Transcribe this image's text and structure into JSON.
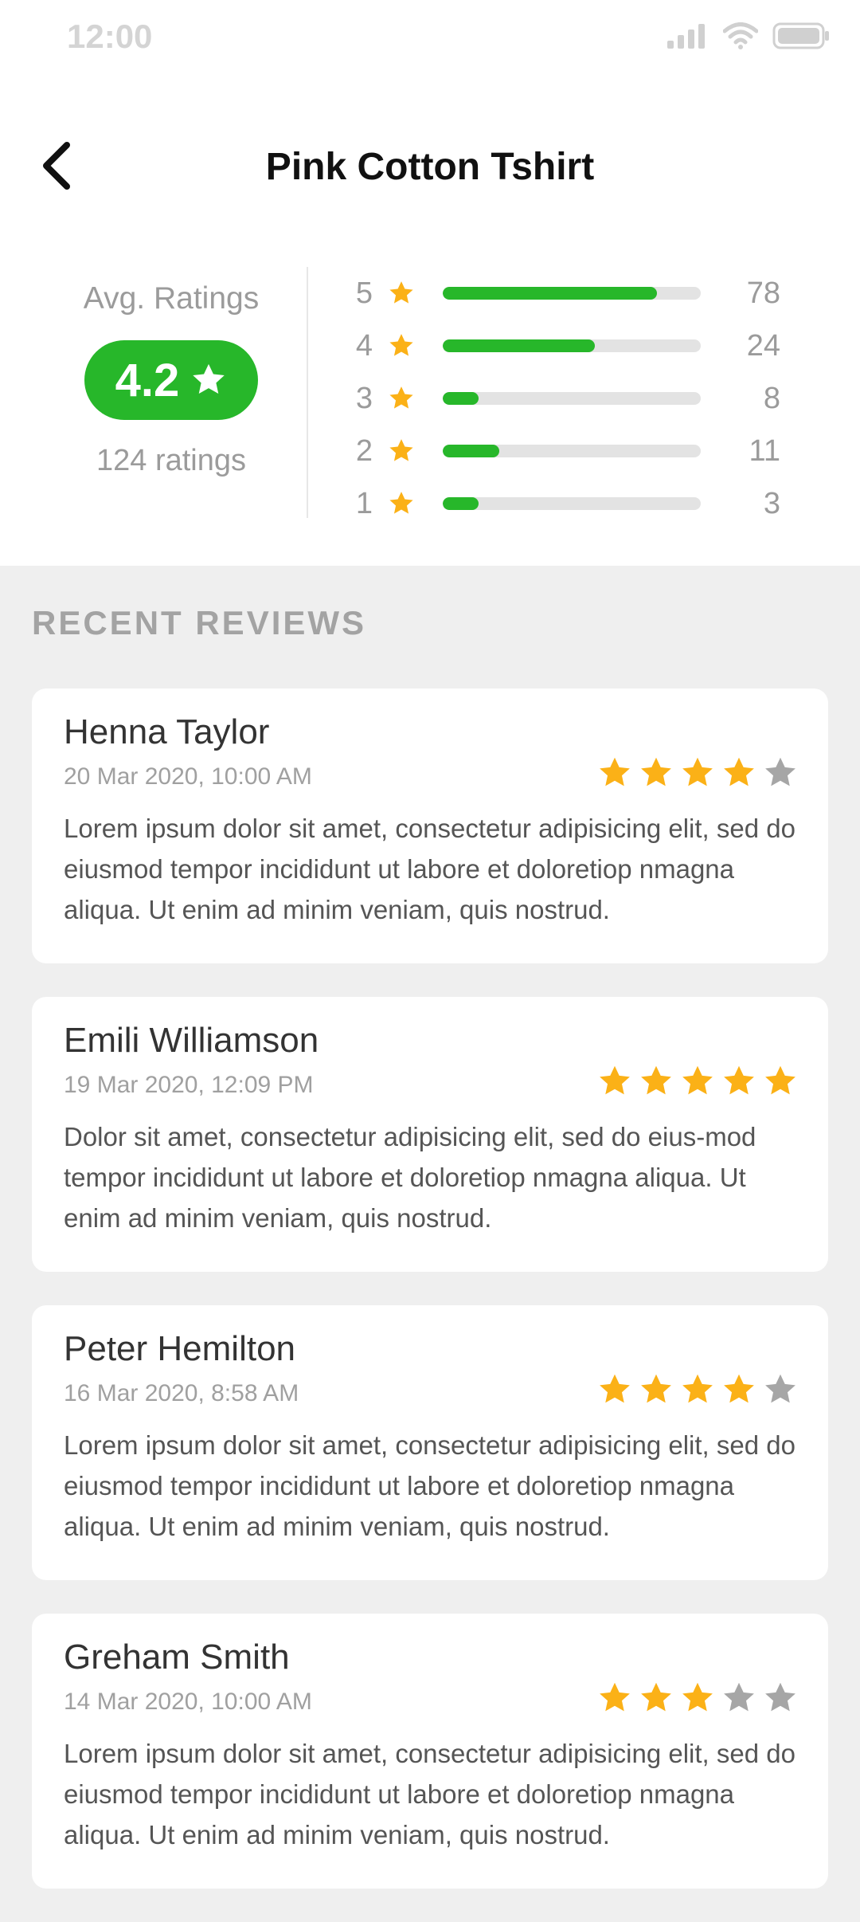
{
  "status_bar": {
    "time": "12:00"
  },
  "header": {
    "title": "Pink Cotton Tshirt"
  },
  "summary": {
    "avg_label": "Avg. Ratings",
    "avg_value": "4.2",
    "ratings_count": "124 ratings",
    "distribution": [
      {
        "stars": "5",
        "count": "78",
        "fraction": 0.83
      },
      {
        "stars": "4",
        "count": "24",
        "fraction": 0.59
      },
      {
        "stars": "3",
        "count": "8",
        "fraction": 0.14
      },
      {
        "stars": "2",
        "count": "11",
        "fraction": 0.22
      },
      {
        "stars": "1",
        "count": "3",
        "fraction": 0.14
      }
    ]
  },
  "section_title": "RECENT REVIEWS",
  "reviews": [
    {
      "name": "Henna Taylor",
      "date": "20 Mar 2020, 10:00 AM",
      "rating": 4,
      "text": "Lorem ipsum dolor sit amet, consectetur adipisicing elit, sed do eiusmod tempor incididunt ut labore et doloretiop nmagna aliqua. Ut enim ad minim veniam, quis nostrud."
    },
    {
      "name": "Emili Williamson",
      "date": "19 Mar 2020, 12:09 PM",
      "rating": 5,
      "text": "Dolor sit amet, consectetur adipisicing elit, sed do eius-mod tempor incididunt ut labore et doloretiop nmagna aliqua. Ut enim ad minim veniam, quis nostrud."
    },
    {
      "name": "Peter Hemilton",
      "date": "16 Mar 2020, 8:58 AM",
      "rating": 4,
      "text": "Lorem ipsum dolor sit amet, consectetur adipisicing elit, sed do eiusmod tempor incididunt ut labore et doloretiop nmagna aliqua. Ut enim ad minim veniam, quis nostrud."
    },
    {
      "name": "Greham Smith",
      "date": "14 Mar 2020, 10:00 AM",
      "rating": 3,
      "text": "Lorem ipsum dolor sit amet, consectetur adipisicing elit, sed do eiusmod tempor incididunt ut labore et doloretiop nmagna aliqua. Ut enim ad minim veniam, quis nostrud."
    }
  ],
  "colors": {
    "accent": "#27b72a",
    "star": "#fbb117",
    "star_empty": "#a6a6a6"
  },
  "icons": {
    "back": "back-arrow-icon",
    "star": "star-icon"
  }
}
